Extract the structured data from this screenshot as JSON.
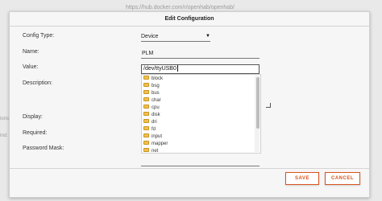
{
  "background": {
    "url_text": "https://hub.docker.com/r/openhab/openhab/",
    "left_fragment_1": "ions",
    "left_fragment_2": "ind:"
  },
  "dialog": {
    "title": "Edit Configuration",
    "labels": {
      "config_type": "Config Type:",
      "name": "Name:",
      "value": "Value:",
      "description": "Description:",
      "display": "Display:",
      "required": "Required:",
      "password_mask": "Password Mask:"
    },
    "config_type": {
      "selected": "Device",
      "icon": "caret-down-icon"
    },
    "name_value": "PLM",
    "value_input": "/dev/ttyUSB0",
    "suggestions": {
      "icon": "folder-icon",
      "items": [
        "block",
        "bsg",
        "bus",
        "char",
        "cpu",
        "disk",
        "dri",
        "fd",
        "input",
        "mapper",
        "net"
      ]
    },
    "buttons": {
      "save": "SAVE",
      "cancel": "CANCEL"
    },
    "colors": {
      "accent": "#d9541e",
      "folder": "#f0c050"
    }
  }
}
